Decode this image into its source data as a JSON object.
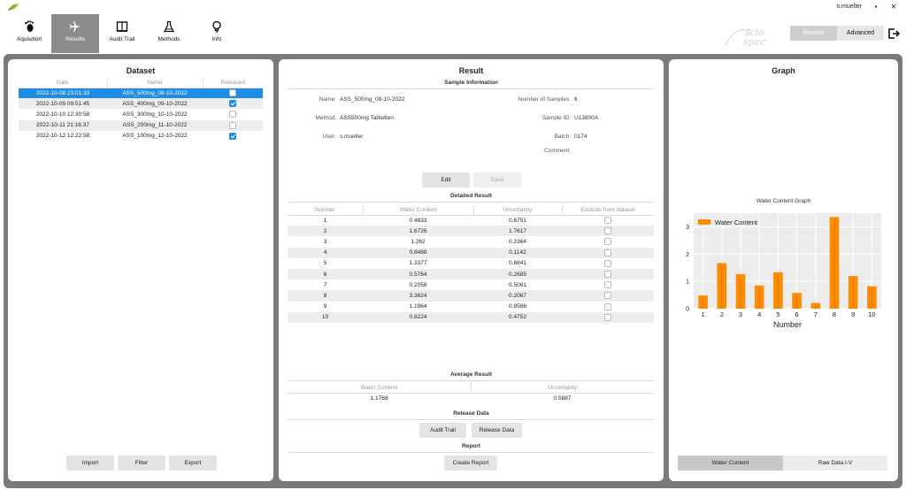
{
  "window": {
    "user": "s.mueller",
    "minimize_glyph": "▪",
    "close_glyph": "✕"
  },
  "nav": [
    {
      "label": "Aquisition",
      "icon": "footprint-icon"
    },
    {
      "label": "Results",
      "icon": "airplane-icon"
    },
    {
      "label": "Audit Trail",
      "icon": "book-icon"
    },
    {
      "label": "Methods",
      "icon": "flask-icon"
    },
    {
      "label": "Info",
      "icon": "lightbulb-icon"
    }
  ],
  "mode": {
    "routine": "Routine",
    "advanced": "Advanced"
  },
  "brand": {
    "line1": "scio",
    "line2": "spec"
  },
  "dataset": {
    "title": "Dataset",
    "columns": [
      "Date",
      "Name",
      "Released"
    ],
    "rows": [
      {
        "date": "2022-10-08 23:01:33",
        "name": "ASS_500mg_08-10-2022",
        "released": false
      },
      {
        "date": "2022-10-09 09:51:45",
        "name": "ASS_400mg_09-10-2022",
        "released": true
      },
      {
        "date": "2022-10-10 12:30:58",
        "name": "ASS_300mg_10-10-2022",
        "released": false
      },
      {
        "date": "2022-10-11 21:16:37",
        "name": "ASS_200mg_11-10-2022",
        "released": false
      },
      {
        "date": "2022-10-12 12:22:58",
        "name": "ASS_100mg_12-10-2022",
        "released": true
      }
    ],
    "buttons": {
      "import": "Import",
      "filter": "Filter",
      "export": "Export"
    }
  },
  "result": {
    "title": "Result",
    "sample_info_title": "Sample Information",
    "fields": {
      "name_label": "Name:",
      "name_value": "ASS_500mg_08-10-2022",
      "method_label": "Method:",
      "method_value": "ASS500mg Tabletten",
      "user_label": "User:",
      "user_value": "s.mueller",
      "samples_label": "Number of Samples:",
      "samples_value": "6",
      "sampleid_label": "Sample ID:",
      "sampleid_value": "U13800A",
      "batch_label": "Batch:",
      "batch_value": "0174",
      "comment_label": "Comment:",
      "comment_value": ""
    },
    "edit": "Edit",
    "save": "Save",
    "detailed_title": "Detailed Result",
    "columns": [
      "Number",
      "Water Content",
      "Uncertainty",
      "Exclude from dataset"
    ],
    "rows": [
      {
        "n": "1",
        "wc": "0.4833",
        "u": "0.6751"
      },
      {
        "n": "2",
        "wc": "1.6726",
        "u": "1.7617"
      },
      {
        "n": "3",
        "wc": "1.262",
        "u": "0.2364"
      },
      {
        "n": "4",
        "wc": "0.8488",
        "u": "0.1142"
      },
      {
        "n": "5",
        "wc": "1.3377",
        "u": "0.6841"
      },
      {
        "n": "6",
        "wc": "0.5764",
        "u": "0.2685"
      },
      {
        "n": "7",
        "wc": "0.2058",
        "u": "0.5061"
      },
      {
        "n": "8",
        "wc": "3.3624",
        "u": "0.2067"
      },
      {
        "n": "9",
        "wc": "1.1964",
        "u": "0.9586"
      },
      {
        "n": "10",
        "wc": "0.8224",
        "u": "0.4752"
      }
    ],
    "average_title": "Average Result",
    "average_columns": [
      "Water Content",
      "Uncertainty"
    ],
    "average_values": [
      "1.1768",
      "0.5887"
    ],
    "release_title": "Release Data",
    "audit_trail": "Audit Trail",
    "release_data": "Release Data",
    "report_title": "Report",
    "create_report": "Create Report"
  },
  "graph": {
    "title": "Graph",
    "tab_water": "Water Content",
    "tab_raw": "Raw Data I-V"
  },
  "chart_data": {
    "type": "bar",
    "title": "Water Content Graph",
    "xlabel": "Number",
    "ylabel": "",
    "categories": [
      "1",
      "2",
      "3",
      "4",
      "5",
      "6",
      "7",
      "8",
      "9",
      "10"
    ],
    "series": [
      {
        "name": "Water Content",
        "values": [
          0.4833,
          1.6726,
          1.262,
          0.8488,
          1.3377,
          0.5764,
          0.2058,
          3.3624,
          1.1964,
          0.8224
        ]
      }
    ],
    "yticks": [
      "0",
      "1",
      "2",
      "3"
    ],
    "ylim": [
      0,
      3.5
    ],
    "grid": true,
    "legend": "top-left",
    "color": "#ff8c00"
  }
}
